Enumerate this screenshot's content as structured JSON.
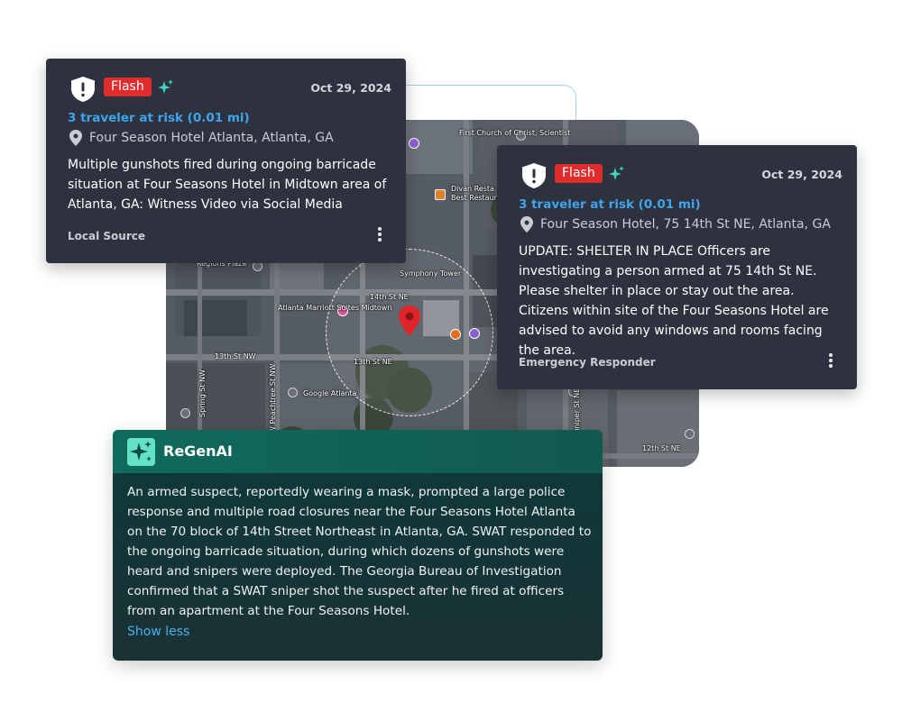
{
  "map": {
    "labels": {
      "first_church": "First Church of Christ, Scientist",
      "divan": "Divan Resta...",
      "best_restaurant": "Best Restaurant in Midtown",
      "regions_plaza": "Regions Plaza",
      "symphony_tower": "Symphony Tower",
      "fourteenth_st": "14th St NE",
      "marriott": "Atlanta Marriott Suites Midtown",
      "thirteenth_nw": "13th St NW",
      "thirteenth_ne": "13th St NE",
      "spring_st": "Spring St NW",
      "w_peachtree": "W Peachtree St NW",
      "google": "Google Atlanta",
      "juniper": "Juniper St NE",
      "twelfth_st": "12th St NE"
    }
  },
  "alerts": [
    {
      "badge": "Flash",
      "date": "Oct 29, 2024",
      "risk": "3 traveler at risk (0.01 mi)",
      "location": "Four Season Hotel Atlanta, Atlanta, GA",
      "body": "Multiple gunshots fired during ongoing barricade situation at Four Seasons Hotel in Midtown area of Atlanta, GA: Witness Video via Social Media",
      "source": "Local Source"
    },
    {
      "badge": "Flash",
      "date": "Oct 29, 2024",
      "risk": "3 traveler at risk (0.01 mi)",
      "location": "Four Season Hotel, 75 14th St NE, Atlanta, GA",
      "body": "UPDATE: SHELTER IN PLACE Officers are investigating a person armed at 75 14th St NE. Please shelter in place or stay out the area. Citizens within site of the Four Seasons Hotel are advised to avoid any windows and rooms facing the area.",
      "source": "Emergency Responder"
    }
  ],
  "regenai": {
    "title": "ReGenAI",
    "body": "An armed suspect, reportedly wearing a mask, prompted a large police response and multiple road closures near the Four Seasons Hotel Atlanta on the 70 block of 14th Street Northeast in Atlanta, GA. SWAT responded to the ongoing barricade situation, during which dozens of gunshots were heard and snipers were deployed. The Georgia Bureau of Investigation confirmed that a SWAT sniper shot the suspect after he fired at officers from an apartment at the Four Seasons Hotel.",
    "show_less": "Show less"
  },
  "colors": {
    "flash_badge": "#e02c2c",
    "risk_text": "#3ea5ec",
    "ai_accent": "#63e1c4",
    "map_pin": "#e0242b",
    "link": "#49b0ee"
  }
}
